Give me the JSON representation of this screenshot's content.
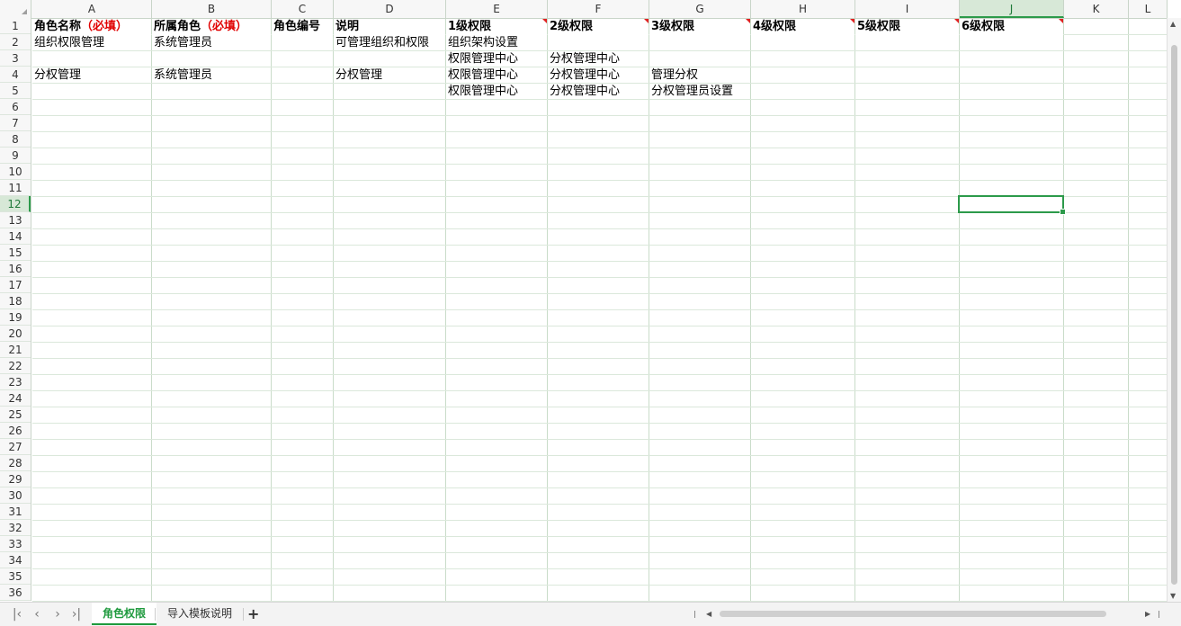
{
  "columns": [
    "A",
    "B",
    "C",
    "D",
    "E",
    "F",
    "G",
    "H",
    "I",
    "J",
    "K",
    "L"
  ],
  "selected_column": "J",
  "selected_row": "12",
  "rows": [
    "1",
    "2",
    "3",
    "4",
    "5",
    "6",
    "7",
    "8",
    "9",
    "10",
    "11",
    "12",
    "13",
    "14",
    "15",
    "16",
    "17",
    "18",
    "19",
    "20",
    "21",
    "22",
    "23",
    "24",
    "25",
    "26",
    "27",
    "28",
    "29",
    "30",
    "31",
    "32",
    "33",
    "34",
    "35",
    "36"
  ],
  "header": {
    "a_main": "角色名称",
    "a_req": "（必填）",
    "b_main": "所属角色",
    "b_req": "（必填）",
    "c": "角色编号",
    "d": "说明",
    "e": "1级权限",
    "f": "2级权限",
    "g": "3级权限",
    "h": "4级权限",
    "i": "5级权限",
    "j": "6级权限"
  },
  "data": {
    "r2": {
      "a": "组织权限管理",
      "b": "系统管理员",
      "d": "可管理组织和权限",
      "e": "组织架构设置"
    },
    "r3": {
      "e": "权限管理中心",
      "f": "分权管理中心"
    },
    "r4": {
      "a": "分权管理",
      "b": "系统管理员",
      "d": "分权管理",
      "e": "权限管理中心",
      "f": "分权管理中心",
      "g": "管理分权"
    },
    "r5": {
      "e": "权限管理中心",
      "f": "分权管理中心",
      "g": "分权管理员设置"
    }
  },
  "sheet_tabs": [
    "角色权限",
    "导入模板说明"
  ],
  "active_tab": "角色权限",
  "add_sheet": "+",
  "colors": {
    "accent": "#1f9a3e",
    "required": "#e00000",
    "comment_flag": "#e02020"
  }
}
